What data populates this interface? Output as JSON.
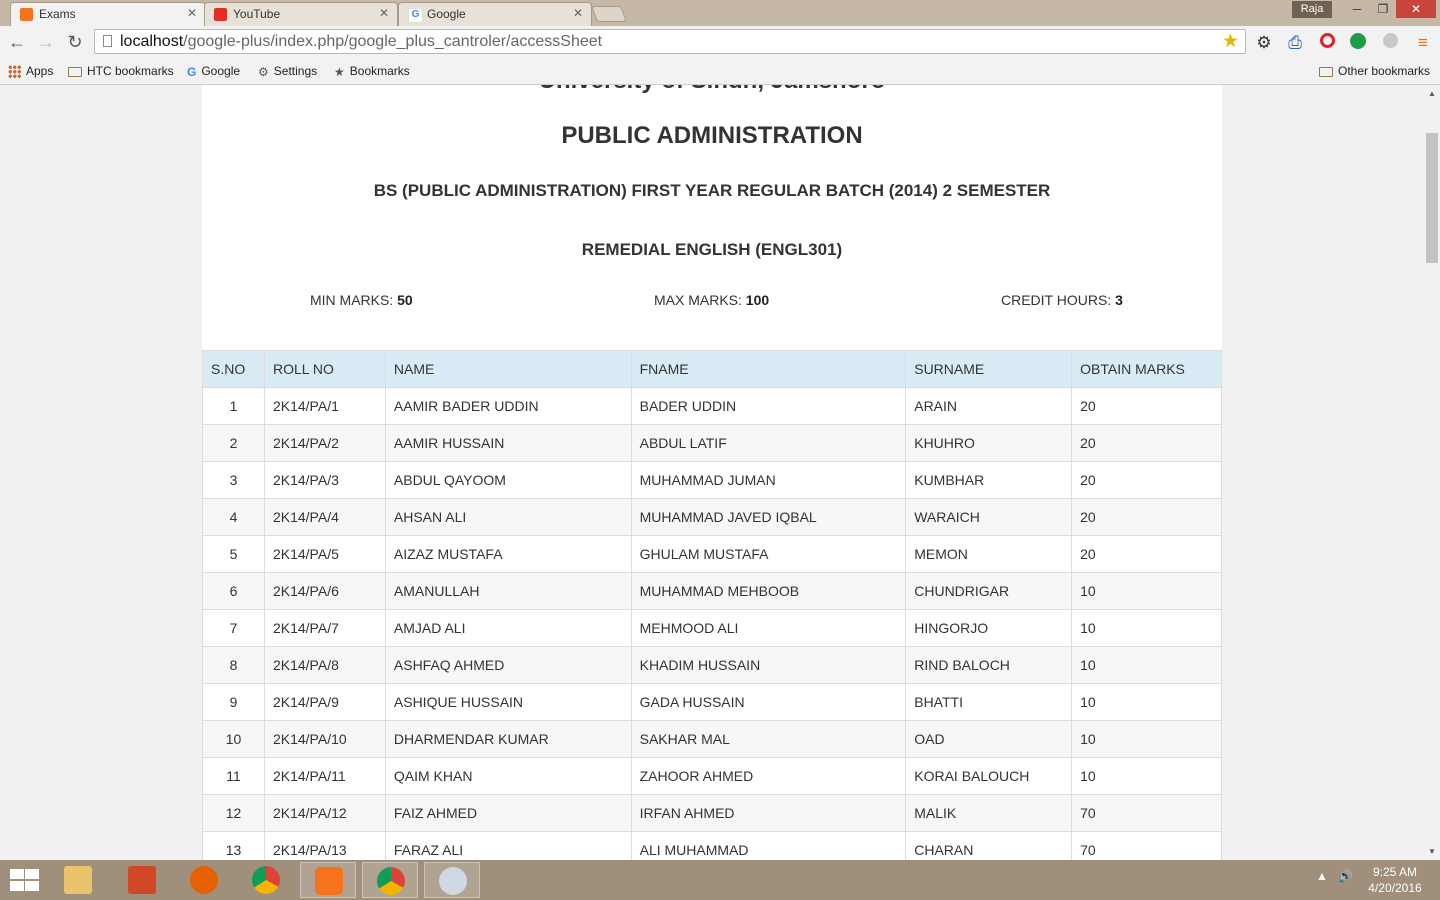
{
  "browser": {
    "tabs": [
      {
        "title": "Exams",
        "active": true,
        "favicon_color": "#f4731c"
      },
      {
        "title": "YouTube",
        "active": false,
        "favicon_color": "#e52d27"
      },
      {
        "title": "Google",
        "active": false,
        "favicon_color": "#4285f4"
      }
    ],
    "user": "Raja",
    "url_host": "localhost",
    "url_path": "/google-plus/index.php/google_plus_cantroler/accessSheet",
    "bookmarks": {
      "apps": "Apps",
      "htc": "HTC bookmarks",
      "google": "Google",
      "settings": "Settings",
      "bookmarks": "Bookmarks",
      "other": "Other bookmarks"
    }
  },
  "page": {
    "university": "University of Sindh, Jamshoro",
    "department": "PUBLIC ADMINISTRATION",
    "batch": "BS (PUBLIC ADMINISTRATION) FIRST YEAR REGULAR BATCH (2014) 2 SEMESTER",
    "course": "REMEDIAL ENGLISH (ENGL301)",
    "min_marks_label": "MIN MARKS:",
    "min_marks_value": "50",
    "max_marks_label": "MAX MARKS:",
    "max_marks_value": "100",
    "credit_hours_label": "CREDIT HOURS:",
    "credit_hours_value": "3"
  },
  "table": {
    "headers": [
      "S.NO",
      "ROLL NO",
      "NAME",
      "FNAME",
      "SURNAME",
      "OBTAIN MARKS"
    ],
    "rows": [
      [
        "1",
        "2K14/PA/1",
        "AAMIR BADER UDDIN",
        "BADER UDDIN",
        "ARAIN",
        "20"
      ],
      [
        "2",
        "2K14/PA/2",
        "AAMIR HUSSAIN",
        "ABDUL LATIF",
        "KHUHRO",
        "20"
      ],
      [
        "3",
        "2K14/PA/3",
        "ABDUL QAYOOM",
        "MUHAMMAD JUMAN",
        "KUMBHAR",
        "20"
      ],
      [
        "4",
        "2K14/PA/4",
        "AHSAN ALI",
        "MUHAMMAD JAVED IQBAL",
        "WARAICH",
        "20"
      ],
      [
        "5",
        "2K14/PA/5",
        "AIZAZ MUSTAFA",
        "GHULAM MUSTAFA",
        "MEMON",
        "20"
      ],
      [
        "6",
        "2K14/PA/6",
        "AMANULLAH",
        "MUHAMMAD MEHBOOB",
        "CHUNDRIGAR",
        "10"
      ],
      [
        "7",
        "2K14/PA/7",
        "AMJAD ALI",
        "MEHMOOD ALI",
        "HINGORJO",
        "10"
      ],
      [
        "8",
        "2K14/PA/8",
        "ASHFAQ AHMED",
        "KHADIM HUSSAIN",
        "RIND BALOCH",
        "10"
      ],
      [
        "9",
        "2K14/PA/9",
        "ASHIQUE HUSSAIN",
        "GADA HUSSAIN",
        "BHATTI",
        "10"
      ],
      [
        "10",
        "2K14/PA/10",
        "DHARMENDAR KUMAR",
        "SAKHAR MAL",
        "OAD",
        "10"
      ],
      [
        "11",
        "2K14/PA/11",
        "QAIM KHAN",
        "ZAHOOR AHMED",
        "KORAI BALOUCH",
        "10"
      ],
      [
        "12",
        "2K14/PA/12",
        "FAIZ AHMED",
        "IRFAN AHMED",
        "MALIK",
        "70"
      ],
      [
        "13",
        "2K14/PA/13",
        "FARAZ ALI",
        "ALI MUHAMMAD",
        "CHARAN",
        "70"
      ]
    ]
  },
  "taskbar": {
    "time": "9:25 AM",
    "date": "4/20/2016"
  }
}
